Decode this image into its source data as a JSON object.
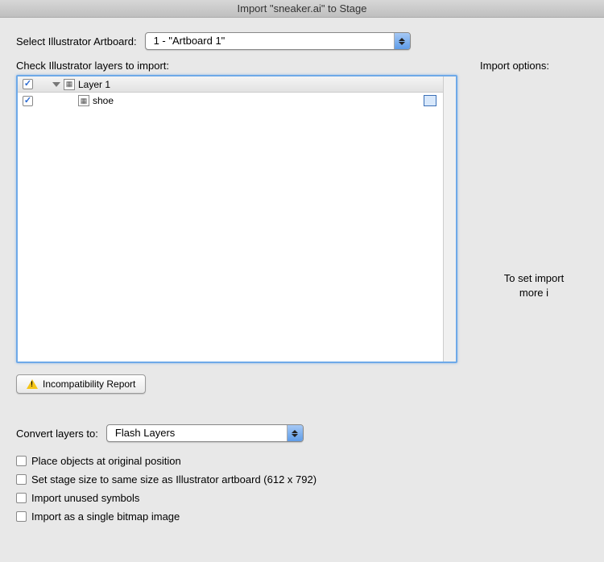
{
  "window": {
    "title": "Import \"sneaker.ai\" to Stage"
  },
  "artboard": {
    "label": "Select Illustrator Artboard:",
    "selected": "1 - \"Artboard 1\""
  },
  "layers": {
    "label": "Check Illustrator layers to import:",
    "items": [
      {
        "name": "Layer 1",
        "checked": true,
        "expanded": true,
        "level": 0
      },
      {
        "name": "shoe",
        "checked": true,
        "level": 1
      }
    ]
  },
  "import_options": {
    "label": "Import options:",
    "hint_line1": "To set import",
    "hint_line2": "more i"
  },
  "incompat_button": "Incompatibility Report",
  "convert": {
    "label": "Convert layers to:",
    "selected": "Flash Layers"
  },
  "checkboxes": {
    "place_original": {
      "label": "Place objects at original position",
      "checked": false
    },
    "stage_size": {
      "label": "Set stage size to same size as Illustrator artboard (612 x 792)",
      "checked": false
    },
    "unused_symbols": {
      "label": "Import unused symbols",
      "checked": false
    },
    "single_bitmap": {
      "label": "Import as a single bitmap image",
      "checked": false
    }
  }
}
